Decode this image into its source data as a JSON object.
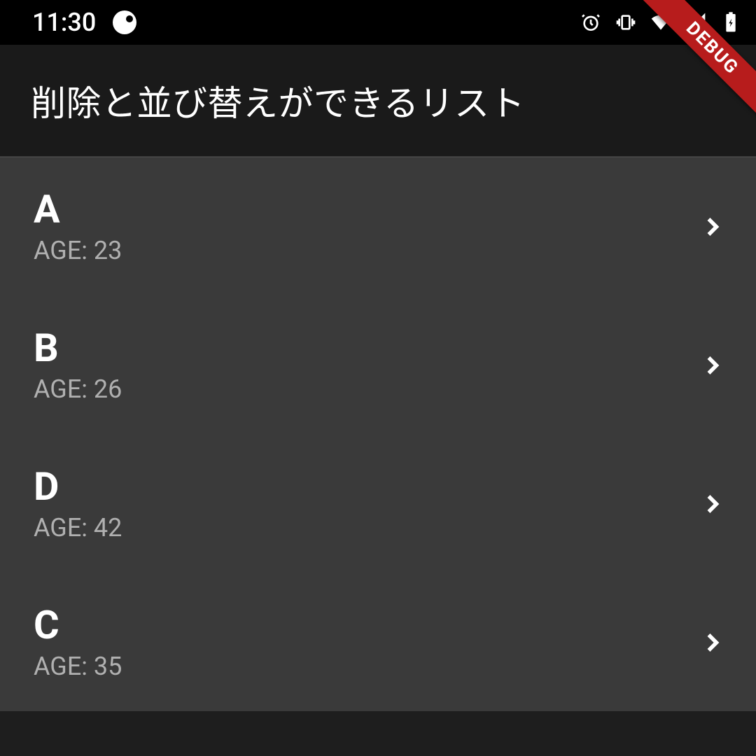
{
  "status": {
    "time": "11:30"
  },
  "app": {
    "title": "削除と並び替えができるリスト",
    "debug_label": "DEBUG"
  },
  "list": {
    "age_prefix": "AGE: ",
    "items": [
      {
        "title": "A",
        "age": "23"
      },
      {
        "title": "B",
        "age": "26"
      },
      {
        "title": "D",
        "age": "42"
      },
      {
        "title": "C",
        "age": "35"
      }
    ]
  }
}
